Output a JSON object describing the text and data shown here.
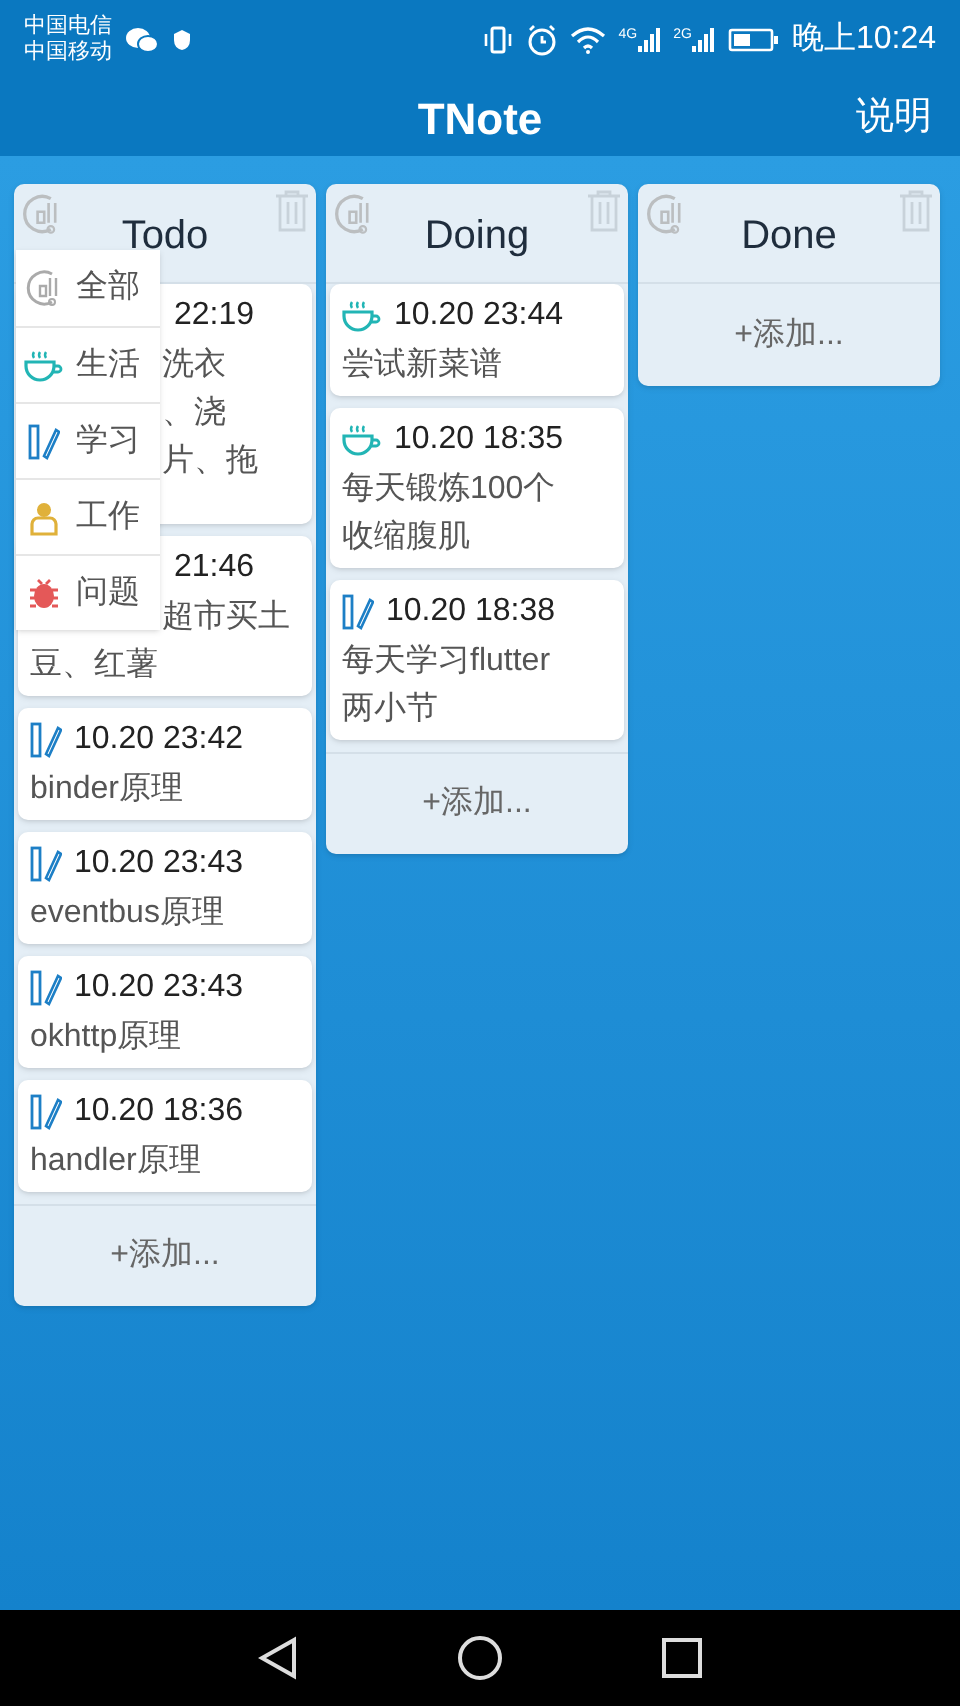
{
  "status_bar": {
    "carriers": [
      "中国电信",
      "中国移动"
    ],
    "networks": [
      "4G",
      "2G"
    ],
    "time": "晚上10:24"
  },
  "app_bar": {
    "title": "TNote",
    "action": "说明"
  },
  "columns": [
    {
      "title": "Todo",
      "add_label": "+添加...",
      "cards": [
        {
          "covered": true,
          "time": "22:19",
          "partial_lines": [
            "洗衣",
            "、浇",
            "片、拖"
          ]
        },
        {
          "covered": true,
          "time": "21:46",
          "partial_lines": [
            "超市买土"
          ],
          "lines": [
            "豆、红薯"
          ]
        },
        {
          "kind": "study",
          "covered": false,
          "time": "10.20 23:42",
          "lines": [
            "binder原理"
          ]
        },
        {
          "kind": "study",
          "covered": false,
          "time": "10.20 23:43",
          "lines": [
            "eventbus原理"
          ]
        },
        {
          "kind": "study",
          "covered": false,
          "time": "10.20 23:43",
          "lines": [
            "okhttp原理"
          ]
        },
        {
          "kind": "study",
          "covered": false,
          "time": "10.20 18:36",
          "lines": [
            "handler原理"
          ]
        }
      ],
      "menu": [
        {
          "kind": "all",
          "label": "全部"
        },
        {
          "kind": "life",
          "label": "生活"
        },
        {
          "kind": "study",
          "label": "学习"
        },
        {
          "kind": "work",
          "label": "工作"
        },
        {
          "kind": "bug",
          "label": "问题"
        }
      ]
    },
    {
      "title": "Doing",
      "add_label": "+添加...",
      "cards": [
        {
          "kind": "life",
          "covered": false,
          "time": "10.20 23:44",
          "lines": [
            "尝试新菜谱"
          ]
        },
        {
          "kind": "life",
          "covered": false,
          "time": "10.20 18:35",
          "lines": [
            "每天锻炼100个",
            "收缩腹肌"
          ]
        },
        {
          "kind": "study",
          "covered": false,
          "time": "10.20 18:38",
          "lines": [
            "每天学习flutter",
            "两小节"
          ]
        }
      ]
    },
    {
      "title": "Done",
      "add_label": "+添加..."
    }
  ]
}
